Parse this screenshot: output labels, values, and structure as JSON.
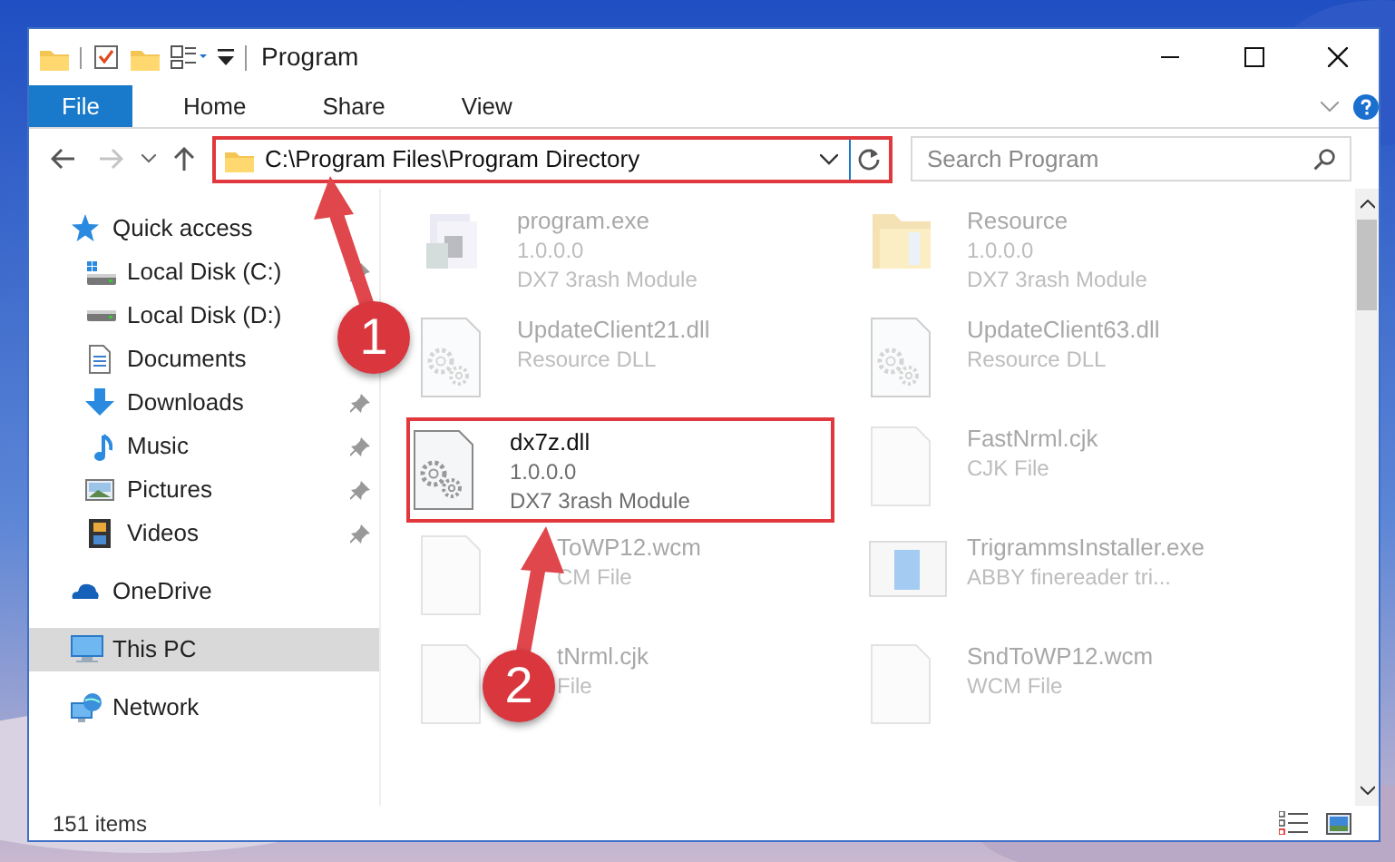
{
  "window": {
    "title": "Program"
  },
  "ribbon_tabs": [
    {
      "label": "File",
      "selected": true
    },
    {
      "label": "Home",
      "selected": false
    },
    {
      "label": "Share",
      "selected": false
    },
    {
      "label": "View",
      "selected": false
    }
  ],
  "address": {
    "path": "C:\\Program Files\\Program Directory",
    "outlined": true
  },
  "search": {
    "placeholder": "Search Program"
  },
  "nav": [
    {
      "label": "Quick access",
      "kind": "star",
      "selected": false,
      "children": [
        {
          "label": "Local Disk (C:)",
          "kind": "disk_win",
          "pinned": true,
          "selected": false
        },
        {
          "label": "Local Disk (D:)",
          "kind": "disk",
          "pinned": false,
          "selected": false
        },
        {
          "label": "Documents",
          "kind": "document",
          "pinned": false,
          "selected": false
        },
        {
          "label": "Downloads",
          "kind": "download",
          "pinned": true,
          "selected": false
        },
        {
          "label": "Music",
          "kind": "music",
          "pinned": true,
          "selected": false
        },
        {
          "label": "Pictures",
          "kind": "pictures",
          "pinned": true,
          "selected": false
        },
        {
          "label": "Videos",
          "kind": "videos",
          "pinned": true,
          "selected": false
        }
      ]
    },
    {
      "label": "OneDrive",
      "kind": "cloud",
      "selected": false
    },
    {
      "label": "This PC",
      "kind": "pc",
      "selected": true
    },
    {
      "label": "Network",
      "kind": "network",
      "selected": false
    }
  ],
  "files": [
    {
      "name": "program.exe",
      "details": [
        "1.0.0.0",
        "DX7 3rash Module"
      ],
      "kind": "exe",
      "emphasized": false
    },
    {
      "name": "Resource",
      "details": [
        "1.0.0.0",
        "DX7 3rash Module"
      ],
      "kind": "folder",
      "emphasized": false
    },
    {
      "name": "UpdateClient21.dll",
      "details": [
        "Resource DLL"
      ],
      "kind": "dll",
      "emphasized": false
    },
    {
      "name": "UpdateClient63.dll",
      "details": [
        "Resource DLL"
      ],
      "kind": "dll",
      "emphasized": false
    },
    {
      "name": "dx7z.dll",
      "details": [
        "1.0.0.0",
        "DX7 3rash Module"
      ],
      "kind": "dll",
      "emphasized": true,
      "outlined": true
    },
    {
      "name": "FastNrml.cjk",
      "details": [
        "CJK File"
      ],
      "kind": "blank",
      "emphasized": false
    },
    {
      "name": "ToWP12.wcm",
      "details": [
        "CM File"
      ],
      "kind": "blank",
      "emphasized": false,
      "covered": true
    },
    {
      "name": "TrigrammsInstaller.exe",
      "details": [
        "ABBY finereader tri..."
      ],
      "kind": "installer",
      "emphasized": false
    },
    {
      "name": "tNrml.cjk",
      "details": [
        "File"
      ],
      "kind": "blank",
      "emphasized": false,
      "covered": true
    },
    {
      "name": "SndToWP12.wcm",
      "details": [
        "WCM File"
      ],
      "kind": "blank",
      "emphasized": false
    }
  ],
  "status_bar": {
    "item_count": "151 items"
  },
  "callouts": [
    {
      "number": "1"
    },
    {
      "number": "2"
    }
  ]
}
